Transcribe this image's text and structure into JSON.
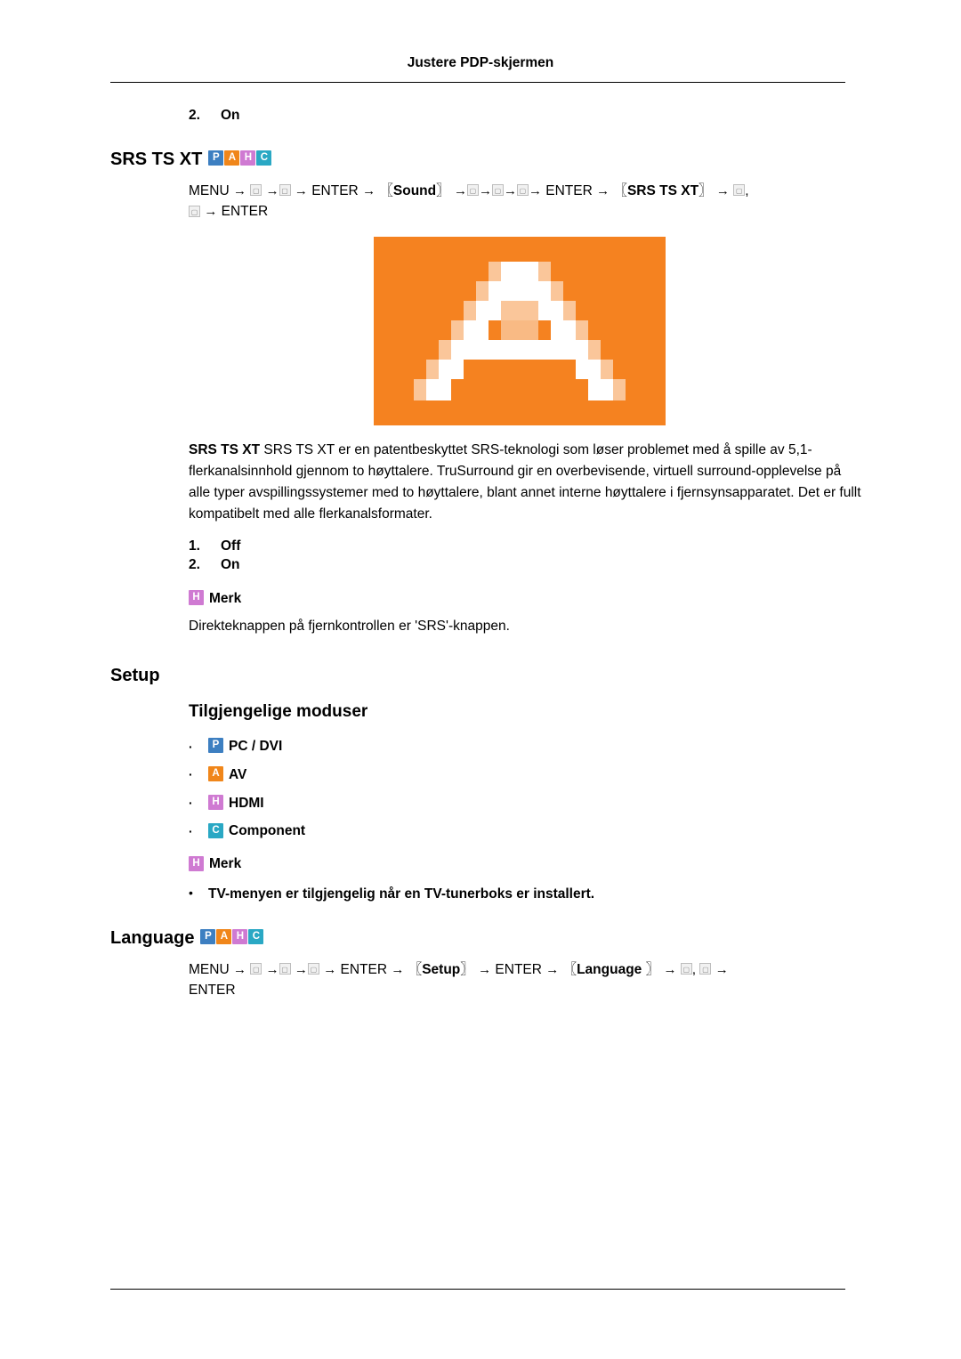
{
  "header": {
    "running_title": "Justere PDP-skjermen"
  },
  "top_option": {
    "number": "2.",
    "label": "On"
  },
  "srs_section": {
    "title": "SRS TS XT",
    "badges": [
      "P",
      "A",
      "H",
      "C"
    ],
    "menu_path_line1": {
      "menu": "MENU",
      "enter1": "ENTER",
      "sound": "Sound",
      "enter2": "ENTER",
      "srs": "SRS TS XT",
      "arrow": "→"
    },
    "menu_path_line2": {
      "enter": "ENTER"
    },
    "description": "SRS TS XT er en patentbeskyttet SRS-teknologi som løser problemet med å spille av 5,1-flerkanalsinnhold gjennom to høyttalere. TruSurround gir en overbevisende, virtuell surround-opplevelse på alle typer avspillingssystemer med to høyttalere, blant annet interne høyttalere i fjernsynsapparatet. Det er fullt kompatibelt med alle flerkanalsformater.",
    "description_lead": "SRS TS XT",
    "options": [
      {
        "number": "1.",
        "label": "Off"
      },
      {
        "number": "2.",
        "label": "On"
      }
    ],
    "note_label": "Merk",
    "note_badge": "H",
    "note_text": "Direkteknappen på fjernkontrollen er 'SRS'-knappen."
  },
  "setup_section": {
    "title": "Setup",
    "subtitle": "Tilgjengelige moduser",
    "modes": [
      {
        "badge": "P",
        "badge_color": "blue",
        "label": "PC / DVI"
      },
      {
        "badge": "A",
        "badge_color": "orange",
        "label": "AV"
      },
      {
        "badge": "H",
        "badge_color": "purple",
        "label": "HDMI"
      },
      {
        "badge": "C",
        "badge_color": "cyan",
        "label": "Component"
      }
    ],
    "note_label": "Merk",
    "note_badge": "H",
    "tv_note_prefix": "TV",
    "tv_note_rest": "-menyen er tilgjengelig når en TV-tunerboks er installert."
  },
  "language_section": {
    "title": "Language",
    "badges": [
      "P",
      "A",
      "H",
      "C"
    ],
    "menu_path_line1": {
      "menu": "MENU",
      "enter1": "ENTER",
      "setup": "Setup",
      "enter2": "ENTER",
      "language": "Language",
      "arrow": "→"
    },
    "menu_path_line2": {
      "enter": "ENTER"
    }
  },
  "colors": {
    "badge_p": "#3d7fc1",
    "badge_a": "#f0861a",
    "badge_h": "#cf7ad2",
    "badge_c": "#2aa8c4",
    "image_background": "#f58220",
    "image_letter": "#ffffff"
  }
}
